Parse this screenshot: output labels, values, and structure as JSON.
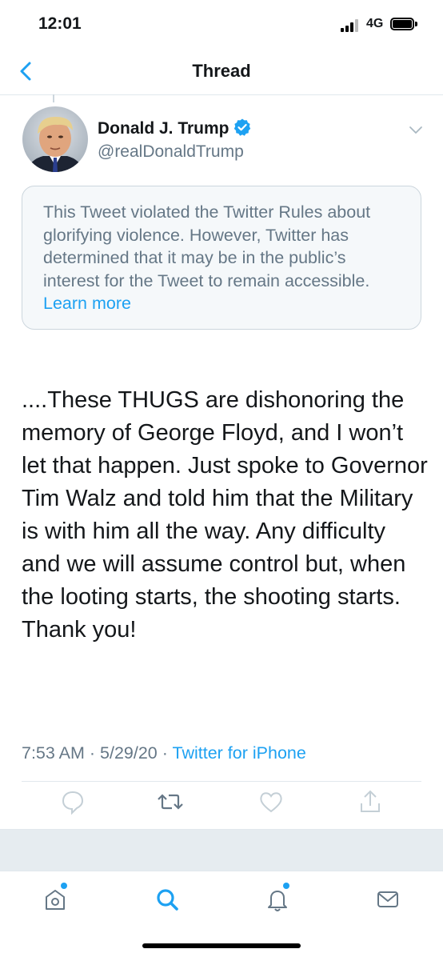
{
  "status_bar": {
    "time": "12:01",
    "network": "4G"
  },
  "header": {
    "title": "Thread"
  },
  "tweet": {
    "author_name": "Donald J. Trump",
    "author_handle": "@realDonaldTrump",
    "verified": true,
    "notice_text": "This Tweet violated the Twitter Rules about glorifying violence. However, Twitter has determined that it may be in the public’s interest for the Tweet to remain accessible.",
    "notice_link": "Learn more",
    "body": "....These THUGS are dishonoring the memory of George Floyd, and I won’t let that happen. Just spoke to Governor Tim Walz and told him that the Military is with him all the way. Any difficulty and we will assume control but, when the looting starts, the shooting starts. Thank you!",
    "time": "7:53 AM",
    "date": "5/29/20",
    "source": "Twitter for iPhone"
  },
  "actions": [
    "reply-icon",
    "retweet-icon",
    "like-icon",
    "share-icon"
  ],
  "tab_bar": [
    "home-icon",
    "search-icon",
    "notifications-icon",
    "messages-icon"
  ],
  "colors": {
    "accent": "#1da1f2",
    "secondary_text": "#657786",
    "notice_bg": "#f5f8fa",
    "band_bg": "#e6ecf0"
  }
}
